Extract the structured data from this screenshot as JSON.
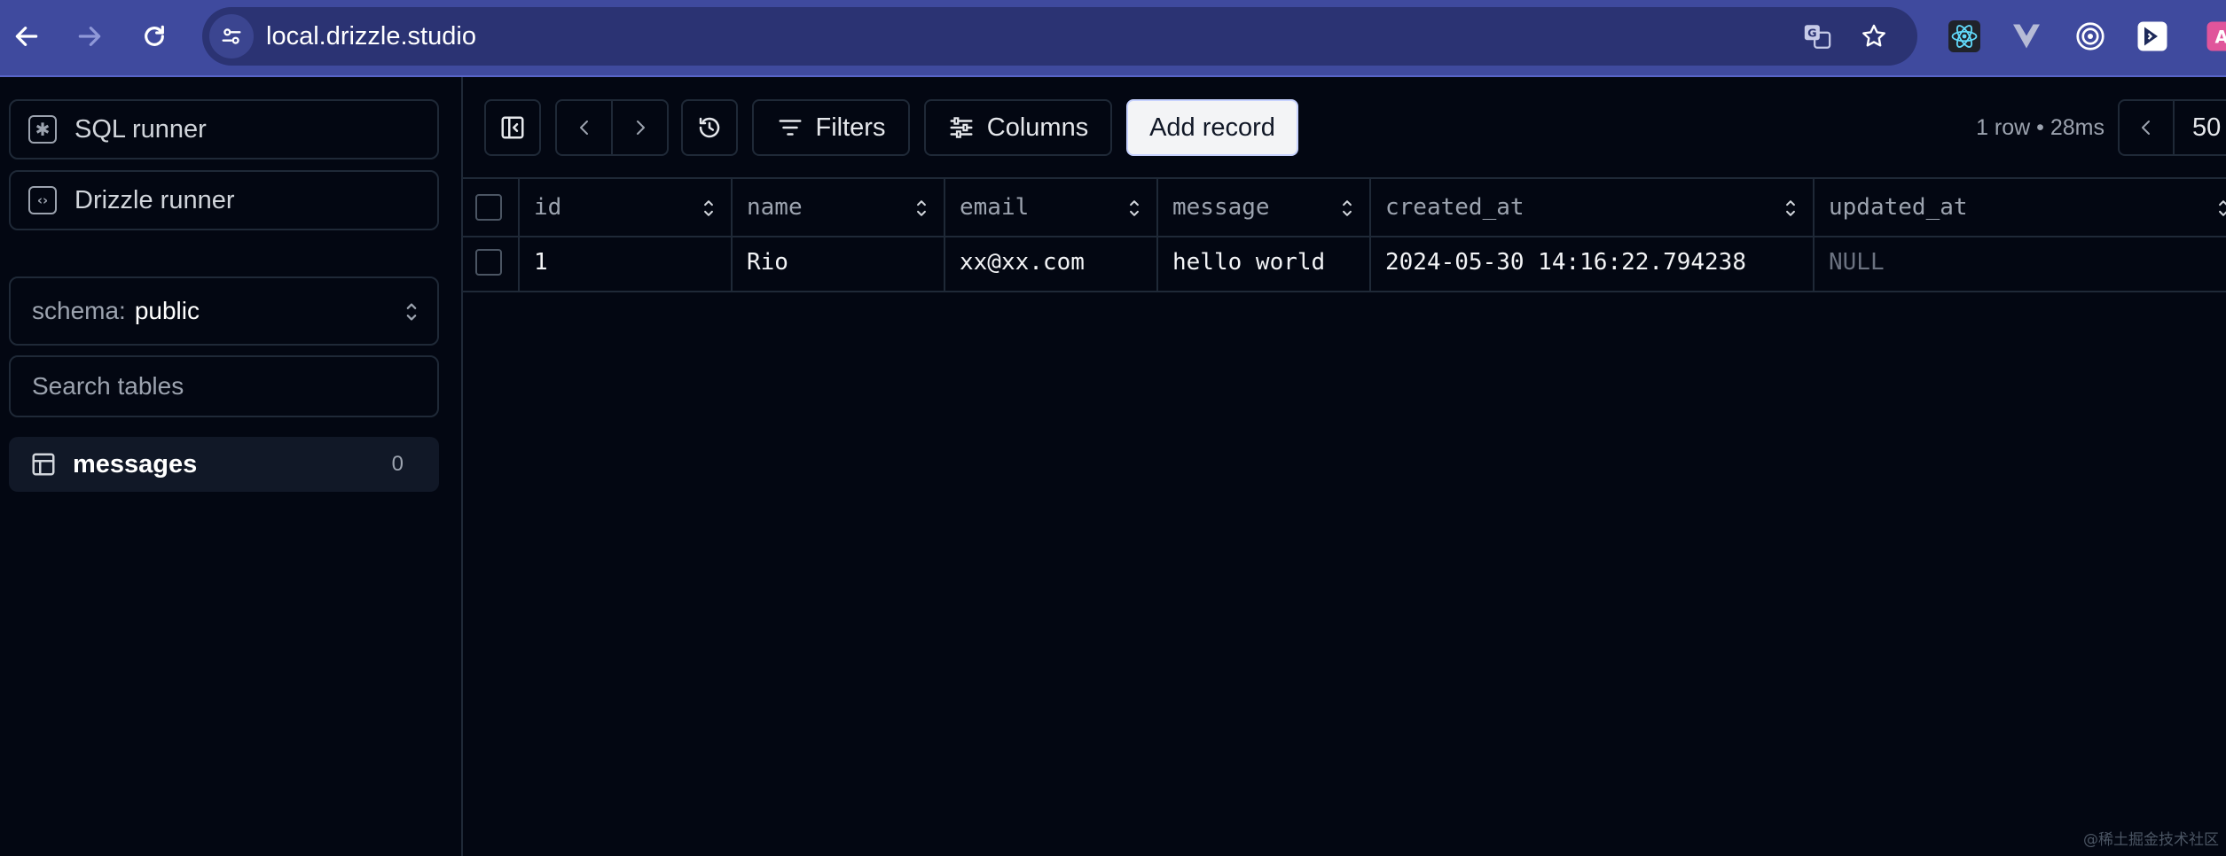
{
  "browser": {
    "url": "local.drizzle.studio"
  },
  "sidebar": {
    "sql_runner": "SQL runner",
    "drizzle_runner": "Drizzle runner",
    "schema_key": "schema:",
    "schema_value": "public",
    "search_placeholder": "Search tables",
    "tables": [
      {
        "label": "messages",
        "count": "0"
      }
    ]
  },
  "toolbar": {
    "filters": "Filters",
    "columns": "Columns",
    "add_record": "Add record",
    "row_info": "1 row • 28ms",
    "page_size": "50"
  },
  "grid": {
    "columns": [
      "id",
      "name",
      "email",
      "message",
      "created_at",
      "updated_at"
    ],
    "rows": [
      {
        "id": "1",
        "name": "Rio",
        "email": "xx@xx.com",
        "message": "hello world",
        "created_at": "2024-05-30 14:16:22.794238",
        "updated_at": "NULL"
      }
    ]
  },
  "watermark": "@稀土掘金技术社区",
  "colors": {
    "background": "#030712",
    "chrome": "#3f4a9e",
    "border": "#1f2937",
    "accent_button": "#f3f4f6"
  }
}
